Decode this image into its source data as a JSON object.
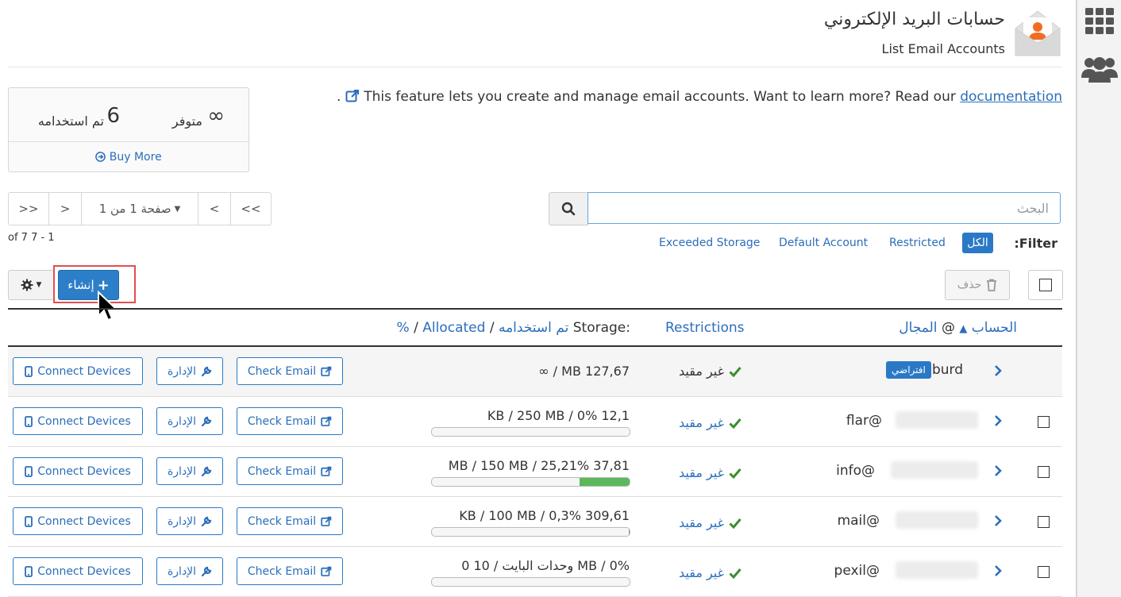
{
  "header": {
    "title_ar": "حسابات البريد الإلكتروني",
    "title_en": "List Email Accounts"
  },
  "stats": {
    "available_value": "∞",
    "available_label": "متوفر",
    "used_value": "6",
    "used_label": "تم استخدامه",
    "buy_more": "Buy More"
  },
  "info": {
    "text": "This feature lets you create and manage email accounts. Want to learn more? Read our",
    "link": "documentation",
    "trailing": "."
  },
  "pagination": {
    "first": ">>",
    "prev": ">",
    "page_label": "صفحة 1 من 1",
    "next": "<",
    "last": "<<",
    "count": "of 7 7 - 1"
  },
  "search": {
    "placeholder": "البحث"
  },
  "filters": {
    "label": ":Filter",
    "all": "الكل",
    "restricted": "Restricted",
    "default_account": "Default Account",
    "exceeded_storage": "Exceeded Storage"
  },
  "actions": {
    "delete": "حذف",
    "create": "إنشاء"
  },
  "table": {
    "col_account": "الحساب",
    "col_at": "@",
    "col_domain": "المجال",
    "col_restrictions": "Restrictions",
    "col_storage_label": ":Storage",
    "col_storage_used": "تم استخدامه",
    "col_storage_sep1": "/",
    "col_storage_allocated": "Allocated",
    "col_storage_sep2": "/",
    "col_storage_pct": "%",
    "rows": [
      {
        "account": "burd",
        "badge": "افتراضي",
        "restriction": "غير مقيد",
        "storage": "∞ / MB 127,67",
        "pct": null
      },
      {
        "account": "flar@",
        "restriction": "غير مقيد",
        "storage": "KB / 250 MB / 0% 12,1",
        "pct": 0
      },
      {
        "account": "info@",
        "restriction": "غير مقيد",
        "storage": "MB / 150 MB / 25,21% 37,81",
        "pct": 25.21
      },
      {
        "account": "mail@",
        "restriction": "غير مقيد",
        "storage": "KB / 100 MB / 0,3% 309,61",
        "pct": 0.3
      },
      {
        "account": "pexil@",
        "restriction": "غير مقيد",
        "storage": "0 وحدات البايت / 10 MB / 0%",
        "pct": 0
      }
    ],
    "btn_check": "Check Email",
    "btn_manage": "الإدارة",
    "btn_connect": "Connect Devices"
  },
  "colors": {
    "primary": "#2a79c7",
    "link": "#2a6ebb",
    "success": "#5cb85c",
    "check": "#3c8d2f",
    "highlight": "#e05050"
  }
}
